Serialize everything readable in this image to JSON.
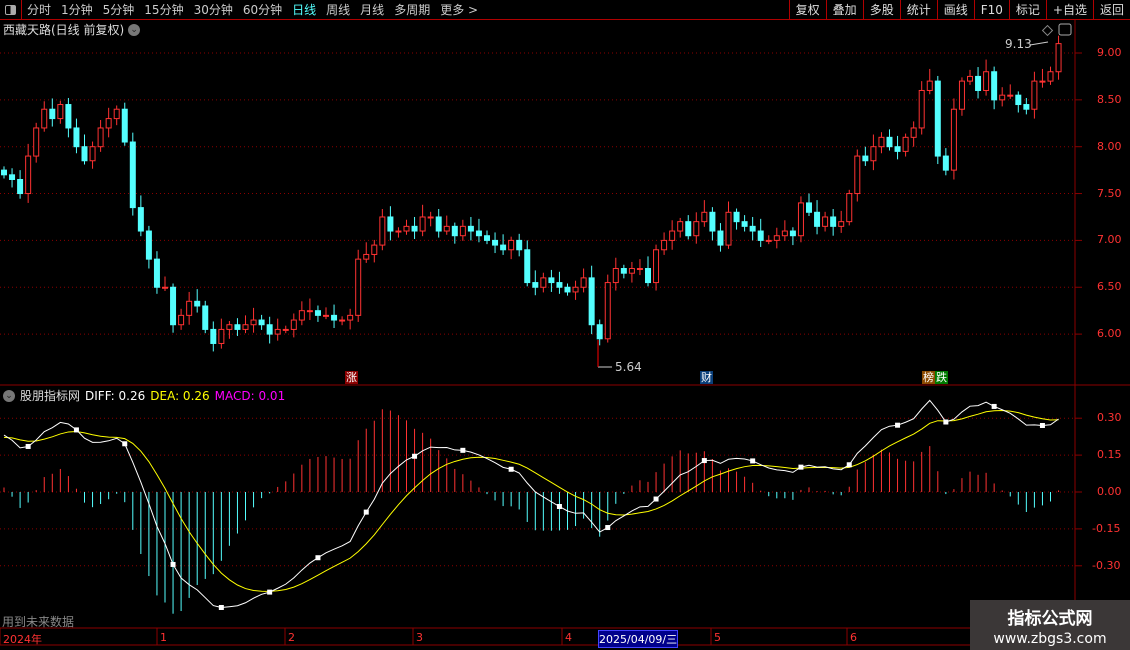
{
  "toolbar": {
    "periods": [
      "分时",
      "1分钟",
      "5分钟",
      "15分钟",
      "30分钟",
      "60分钟",
      "日线",
      "周线",
      "月线",
      "多周期",
      "更多 >"
    ],
    "active": "日线",
    "buttons": [
      "复权",
      "叠加",
      "多股",
      "统计",
      "画线",
      "F10",
      "标记",
      "+自选",
      "返回"
    ]
  },
  "chart_title": "西藏天路(日线 前复权)",
  "price_axis": [
    "9.00",
    "8.50",
    "8.00",
    "7.50",
    "7.00",
    "6.50",
    "6.00"
  ],
  "annotations": {
    "high": "9.13",
    "low": "5.64"
  },
  "markers": [
    {
      "text": "涨",
      "color": "#8b0000"
    },
    {
      "text": "财",
      "color": "#0a3f7a"
    },
    {
      "text": "榜",
      "color": "#8b4a00"
    },
    {
      "text": "跌",
      "color": "#007a00"
    }
  ],
  "indicator": {
    "name": "股朋指标网",
    "diff": "DIFF: 0.26",
    "dea": "DEA: 0.26",
    "macd": "MACD: 0.01"
  },
  "macd_axis": [
    "0.30",
    "0.15",
    "0.00",
    "-0.15",
    "-0.30"
  ],
  "date_axis": [
    "2024年",
    "1",
    "2",
    "3",
    "4",
    "2025/04/09/三",
    "5",
    "6"
  ],
  "footer_note": "用到未来数据",
  "watermark": {
    "line1": "指标公式网",
    "line2": "www.zbgs3.com"
  },
  "colors": {
    "up": "#ff3232",
    "down": "#54ffff",
    "diff": "#ffffff",
    "dea": "#ffff00",
    "grid": "#8b0000"
  },
  "chart_data": {
    "type": "candlestick",
    "closes": [
      7.7,
      7.65,
      7.5,
      7.9,
      8.2,
      8.4,
      8.3,
      8.45,
      8.2,
      8.0,
      7.85,
      8.0,
      8.2,
      8.3,
      8.4,
      8.05,
      7.35,
      7.1,
      6.8,
      6.5,
      6.5,
      6.1,
      6.2,
      6.35,
      6.3,
      6.05,
      5.9,
      6.05,
      6.1,
      6.05,
      6.1,
      6.15,
      6.1,
      6.0,
      6.05,
      6.05,
      6.15,
      6.25,
      6.25,
      6.2,
      6.2,
      6.15,
      6.15,
      6.2,
      6.8,
      6.85,
      6.95,
      7.25,
      7.1,
      7.1,
      7.15,
      7.1,
      7.25,
      7.25,
      7.1,
      7.15,
      7.05,
      7.15,
      7.1,
      7.05,
      7.0,
      6.95,
      6.9,
      7.0,
      6.9,
      6.55,
      6.5,
      6.6,
      6.55,
      6.5,
      6.45,
      6.5,
      6.6,
      6.1,
      5.95,
      6.55,
      6.7,
      6.65,
      6.7,
      6.7,
      6.55,
      6.9,
      7.0,
      7.1,
      7.2,
      7.05,
      7.2,
      7.3,
      7.1,
      6.95,
      7.3,
      7.2,
      7.15,
      7.1,
      7.0,
      7.0,
      7.05,
      7.1,
      7.05,
      7.4,
      7.3,
      7.15,
      7.25,
      7.15,
      7.2,
      7.5,
      7.9,
      7.85,
      8.0,
      8.1,
      8.0,
      7.95,
      8.1,
      8.2,
      8.6,
      8.7,
      7.9,
      7.75,
      8.4,
      8.7,
      8.75,
      8.6,
      8.8,
      8.5,
      8.55,
      8.55,
      8.45,
      8.4,
      8.7,
      8.7,
      8.8,
      9.1
    ],
    "ylim": [
      5.5,
      9.3
    ],
    "macd_ylim": [
      -0.45,
      0.4
    ]
  }
}
